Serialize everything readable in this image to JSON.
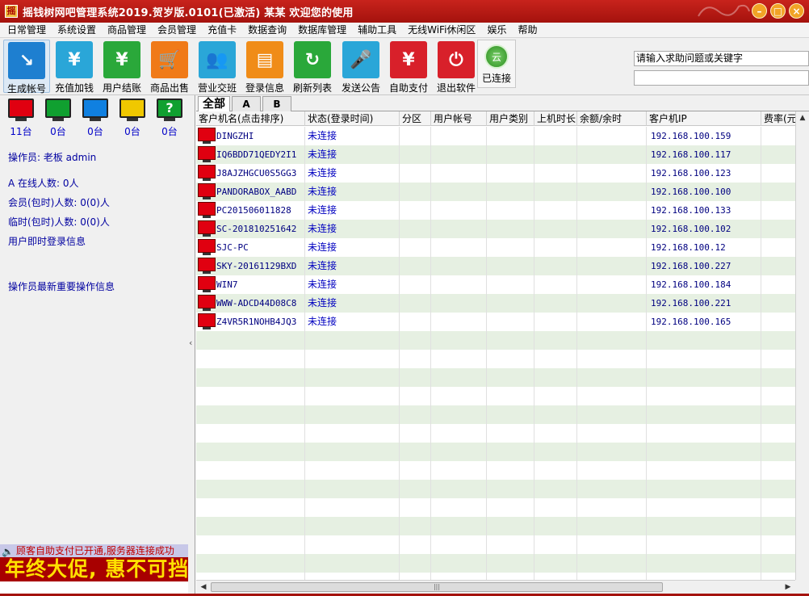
{
  "window": {
    "title": "摇钱树网吧管理系统2019.贺岁版.0101(已激活)  某某 欢迎您的使用",
    "app_icon": "摇",
    "controls": [
      "minimize-icon",
      "maximize-icon",
      "close-icon"
    ]
  },
  "menu": [
    "日常管理",
    "系统设置",
    "商品管理",
    "会员管理",
    "充值卡",
    "数据查询",
    "数据库管理",
    "辅助工具",
    "无线WiFi休闲区",
    "娱乐",
    "帮助"
  ],
  "toolbar": {
    "buttons": [
      {
        "label": "生成帐号",
        "icon": "export-icon",
        "color": "#1e7fd0",
        "glyph": "↘"
      },
      {
        "label": "充值加钱",
        "icon": "cash-card-icon",
        "color": "#2aa6d8",
        "glyph": "¥"
      },
      {
        "label": "用户结账",
        "icon": "checkout-card-icon",
        "color": "#2aa83a",
        "glyph": "¥"
      },
      {
        "label": "商品出售",
        "icon": "shopping-cart-icon",
        "color": "#f07a18",
        "glyph": "🛒"
      },
      {
        "label": "营业交班",
        "icon": "users-icon",
        "color": "#2aa6d8",
        "glyph": "👥"
      },
      {
        "label": "登录信息",
        "icon": "id-card-icon",
        "color": "#f08c18",
        "glyph": "▤"
      },
      {
        "label": "刷新列表",
        "icon": "refresh-icon",
        "color": "#2aa83a",
        "glyph": "↻"
      },
      {
        "label": "发送公告",
        "icon": "microphone-icon",
        "color": "#2aa6d8",
        "glyph": "🎤"
      },
      {
        "label": "自助支付",
        "icon": "self-pay-icon",
        "color": "#d8202a",
        "glyph": "¥"
      },
      {
        "label": "退出软件",
        "icon": "power-icon",
        "color": "#d8202a",
        "glyph": "⏻"
      }
    ],
    "cloud": {
      "label": "已连接",
      "glyph": "云"
    },
    "search_placeholder": "请输入求助问题或关键字"
  },
  "left_panel": {
    "monitors": [
      {
        "count": "11台",
        "color": "#e00010"
      },
      {
        "count": "0台",
        "color": "#10a030"
      },
      {
        "count": "0台",
        "color": "#1080e0"
      },
      {
        "count": "0台",
        "color": "#f0c800"
      },
      {
        "count": "0台",
        "color": "#10a030",
        "glyph": "?"
      }
    ],
    "operator": "操作员:  老板 admin",
    "online": "A 在线人数: 0人",
    "members": "会员(包时)人数: 0(0)人",
    "temp": "临时(包时)人数: 0(0)人",
    "login_info": "用户即时登录信息",
    "op_info": "操作员最新重要操作信息",
    "notice": "顾客自助支付已开通,服务器连接成功",
    "promo": "年终大促, 惠不可挡"
  },
  "tabs": [
    "全部",
    "A",
    "B"
  ],
  "grid": {
    "columns": [
      "客户机名(点击排序)",
      "状态(登录时间)",
      "分区",
      "用户帐号",
      "用户类别",
      "上机时长",
      "余额/余时",
      "客户机IP",
      "费率(元/小时)"
    ],
    "rows": [
      {
        "name": "DINGZHI",
        "status": "未连接",
        "ip": "192.168.100.159"
      },
      {
        "name": "IQ6BDD71QEDY2I1",
        "status": "未连接",
        "ip": "192.168.100.117"
      },
      {
        "name": "J8AJZHGCU0S5GG3",
        "status": "未连接",
        "ip": "192.168.100.123"
      },
      {
        "name": "PANDORABOX_AABD",
        "status": "未连接",
        "ip": "192.168.100.100"
      },
      {
        "name": "PC201506011828",
        "status": "未连接",
        "ip": "192.168.100.133"
      },
      {
        "name": "SC-201810251642",
        "status": "未连接",
        "ip": "192.168.100.102"
      },
      {
        "name": "SJC-PC",
        "status": "未连接",
        "ip": "192.168.100.12"
      },
      {
        "name": "SKY-20161129BXD",
        "status": "未连接",
        "ip": "192.168.100.227"
      },
      {
        "name": "WIN7",
        "status": "未连接",
        "ip": "192.168.100.184"
      },
      {
        "name": "WWW-ADCD44D08C8",
        "status": "未连接",
        "ip": "192.168.100.221"
      },
      {
        "name": "Z4VR5R1NOHB4JQ3",
        "status": "未连接",
        "ip": "192.168.100.165"
      }
    ]
  }
}
